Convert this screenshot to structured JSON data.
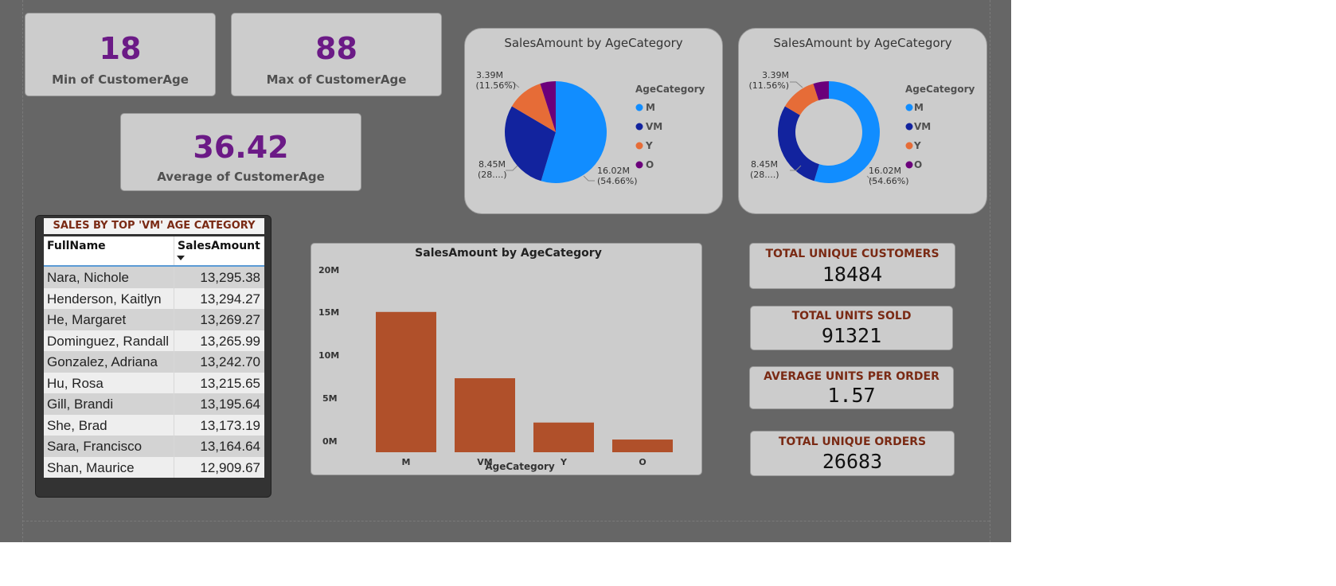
{
  "colors": {
    "canvas": "#666666",
    "card": "#cccccc",
    "kpi_value": "#6b1a86",
    "metric_label": "#7a2a14",
    "bar": "#b0502a",
    "M": "#118dff",
    "VM": "#12239e",
    "Y": "#e66c37",
    "O": "#6b007b"
  },
  "kpis": {
    "min": {
      "value": "18",
      "label": "Min of CustomerAge"
    },
    "max": {
      "value": "88",
      "label": "Max of CustomerAge"
    },
    "avg": {
      "value": "36.42",
      "label": "Average of CustomerAge"
    }
  },
  "pie": {
    "title": "SalesAmount by AgeCategory",
    "legend_title": "AgeCategory",
    "legend": [
      "M",
      "VM",
      "Y",
      "O"
    ],
    "labels": {
      "y_value": "3.39M",
      "y_pct": "(11.56%)",
      "vm_value": "8.45M",
      "vm_pct": "(28....)",
      "m_value": "16.02M",
      "m_pct": "(54.66%)"
    }
  },
  "donut": {
    "title": "SalesAmount by AgeCategory",
    "legend_title": "AgeCategory",
    "legend": [
      "M",
      "VM",
      "Y",
      "O"
    ],
    "labels": {
      "y_value": "3.39M",
      "y_pct": "(11.56%)",
      "vm_value": "8.45M",
      "vm_pct": "(28....)",
      "m_value": "16.02M",
      "m_pct": "(54.66%)"
    }
  },
  "table": {
    "title": "SALES BY TOP 'VM' AGE CATEGORY",
    "columns": [
      "FullName",
      "SalesAmount"
    ],
    "rows": [
      [
        "Nara, Nichole",
        "13,295.38"
      ],
      [
        "Henderson, Kaitlyn",
        "13,294.27"
      ],
      [
        "He, Margaret",
        "13,269.27"
      ],
      [
        "Dominguez, Randall",
        "13,265.99"
      ],
      [
        "Gonzalez, Adriana",
        "13,242.70"
      ],
      [
        "Hu, Rosa",
        "13,215.65"
      ],
      [
        "Gill, Brandi",
        "13,195.64"
      ],
      [
        "She, Brad",
        "13,173.19"
      ],
      [
        "Sara, Francisco",
        "13,164.64"
      ],
      [
        "Shan, Maurice",
        "12,909.67"
      ]
    ]
  },
  "bar": {
    "title": "SalesAmount by AgeCategory",
    "xlabel": "AgeCategory",
    "yticks": [
      "20M",
      "15M",
      "10M",
      "5M",
      "0M"
    ]
  },
  "metrics": {
    "customers": {
      "label": "TOTAL UNIQUE CUSTOMERS",
      "value": "18484"
    },
    "units": {
      "label": "TOTAL UNITS SOLD",
      "value": "91321"
    },
    "avg_units": {
      "label": "AVERAGE UNITS PER ORDER",
      "value": "1.57"
    },
    "orders": {
      "label": "TOTAL UNIQUE ORDERS",
      "value": "26683"
    }
  },
  "chart_data": [
    {
      "type": "pie",
      "title": "SalesAmount by AgeCategory",
      "legend_title": "AgeCategory",
      "categories": [
        "M",
        "VM",
        "Y",
        "O"
      ],
      "values": [
        16.02,
        8.45,
        3.39,
        1.45
      ],
      "unit": "M",
      "percentages": [
        54.66,
        28.83,
        11.56,
        4.95
      ],
      "legend_position": "right"
    },
    {
      "type": "pie",
      "variant": "donut",
      "title": "SalesAmount by AgeCategory",
      "legend_title": "AgeCategory",
      "categories": [
        "M",
        "VM",
        "Y",
        "O"
      ],
      "values": [
        16.02,
        8.45,
        3.39,
        1.45
      ],
      "unit": "M",
      "percentages": [
        54.66,
        28.83,
        11.56,
        4.95
      ],
      "legend_position": "right"
    },
    {
      "type": "bar",
      "title": "SalesAmount by AgeCategory",
      "categories": [
        "M",
        "VM",
        "Y",
        "O"
      ],
      "values": [
        16.02,
        8.45,
        3.39,
        1.45
      ],
      "unit": "M",
      "xlabel": "AgeCategory",
      "ylabel": "",
      "ylim": [
        0,
        20
      ],
      "yticks": [
        0,
        5,
        10,
        15,
        20
      ],
      "grid": false
    },
    {
      "type": "table",
      "title": "SALES BY TOP 'VM' AGE CATEGORY",
      "columns": [
        "FullName",
        "SalesAmount"
      ],
      "rows": [
        [
          "Nara, Nichole",
          13295.38
        ],
        [
          "Henderson, Kaitlyn",
          13294.27
        ],
        [
          "He, Margaret",
          13269.27
        ],
        [
          "Dominguez, Randall",
          13265.99
        ],
        [
          "Gonzalez, Adriana",
          13242.7
        ],
        [
          "Hu, Rosa",
          13215.65
        ],
        [
          "Gill, Brandi",
          13195.64
        ],
        [
          "She, Brad",
          13173.19
        ],
        [
          "Sara, Francisco",
          13164.64
        ],
        [
          "Shan, Maurice",
          12909.67
        ]
      ]
    }
  ]
}
